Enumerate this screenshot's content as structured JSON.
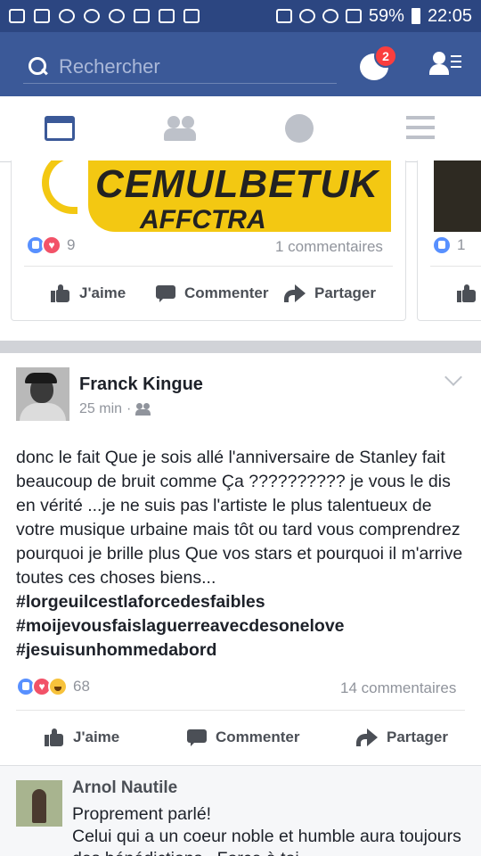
{
  "status_bar": {
    "battery": "59%",
    "time": "22:05"
  },
  "header": {
    "search_placeholder": "Rechercher",
    "messages_badge": "2"
  },
  "carousel": {
    "card1": {
      "image_text_1": "CEMULBETUK",
      "image_text_2": "AFFCTRA",
      "reaction_count": "9",
      "comments": "1 commentaires",
      "actions": {
        "like": "J'aime",
        "comment": "Commenter",
        "share": "Partager"
      }
    },
    "card2": {
      "reaction_count": "1"
    }
  },
  "post": {
    "author": "Franck Kingue",
    "time": "25 min",
    "body": "donc le fait Que je sois allé  l'anniversaire de Stanley fait beaucoup de bruit comme Ça ?????????? je vous le dis en vérité ...je ne suis pas l'artiste le plus talentueux  de votre musique urbaine mais tôt ou tard vous comprendrez pourquoi je brille plus Que vos stars et pourquoi il m'arrive toutes ces choses biens...",
    "hashtags": [
      "#lorgeuilcestlaforcedesfaibles",
      "#moijevousfaislaguerreavecdesonelove",
      "#jesuisunhommedabord"
    ],
    "reaction_count": "68",
    "comments": "14 commentaires",
    "actions": {
      "like": "J'aime",
      "comment": "Commenter",
      "share": "Partager"
    }
  },
  "comment": {
    "author": "Arnol Nautile",
    "text": "Proprement parlé!\nCelui qui a un coeur noble et humble aura toujours des bénédictions . Force à toi"
  },
  "colors": {
    "facebook_blue": "#3b5998",
    "status_bar": "#2c4681",
    "like_blue": "#5890ff",
    "love_red": "#f25268",
    "badge_red": "#fa3e3e"
  }
}
